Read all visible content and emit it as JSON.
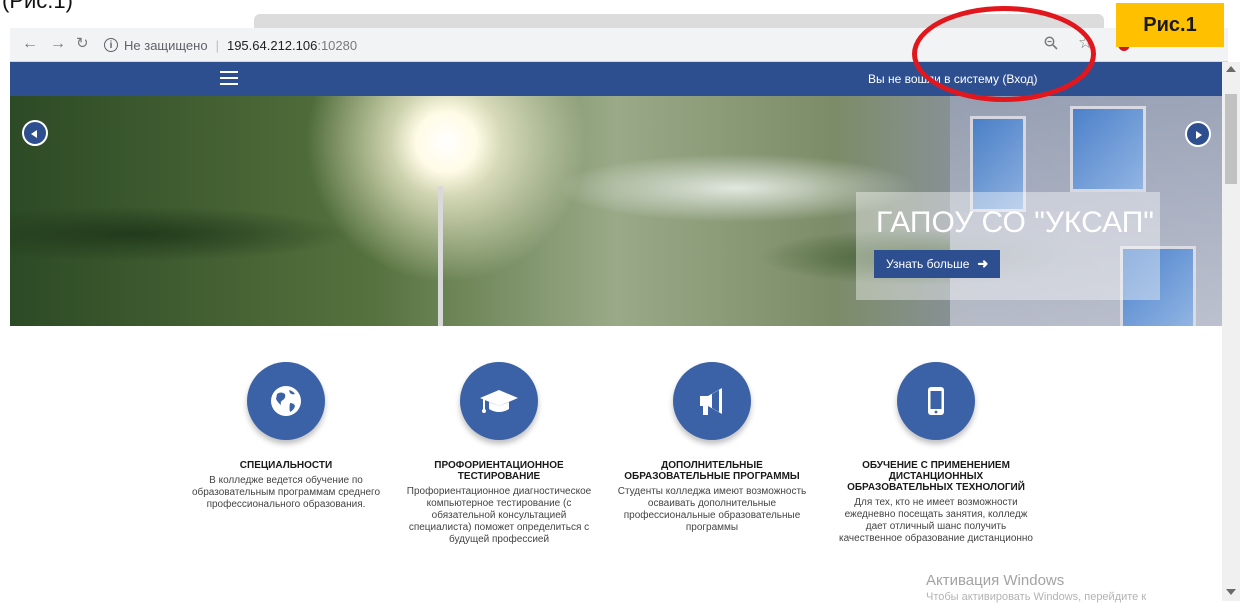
{
  "caption": "(Рис.1)",
  "browser": {
    "security_label": "Не защищено",
    "host": "195.64.212.106",
    "port": ":10280",
    "back_icon": "arrow-left-icon",
    "forward_icon": "arrow-right-icon",
    "reload_icon": "reload-icon"
  },
  "header": {
    "login_text": "Вы не вошли в систему (Вход)"
  },
  "hero": {
    "title": "ГАПОУ СО \"УКСАП\"",
    "button_label": "Узнать больше"
  },
  "features": [
    {
      "icon": "globe-icon",
      "title": "СПЕЦИАЛЬНОСТИ",
      "description": "В колледже ведется обучение по образовательным программам среднего профессионального образования."
    },
    {
      "icon": "graduation-cap-icon",
      "title": "ПРОФОРИЕНТАЦИОННОЕ ТЕСТИРОВАНИЕ",
      "description": "Профориентационное диагностическое компьютерное тестирование (с обязательной консультацией специалиста) поможет определиться с будущей профессией"
    },
    {
      "icon": "megaphone-icon",
      "title": "ДОПОЛНИТЕЛЬНЫЕ ОБРАЗОВАТЕЛЬНЫЕ ПРОГРАММЫ",
      "description": "Студенты колледжа имеют возможность осваивать дополнительные профессиональные образовательные программы"
    },
    {
      "icon": "mobile-phone-icon",
      "title": "ОБУЧЕНИЕ С ПРИМЕНЕНИЕМ ДИСТАНЦИОННЫХ ОБРАЗОВАТЕЛЬНЫХ ТЕХНОЛОГИЙ",
      "description": "Для тех, кто не имеет возможности ежедневно посещать занятия, колледж дает отличный шанс получить качественное образование дистанционно"
    }
  ],
  "figure_label": "Рис.1",
  "watermark": {
    "line1": "Активация Windows",
    "line2": "Чтобы активировать Windows, перейдите к"
  },
  "colors": {
    "header": "#2e4f8f",
    "feature_circle": "#3b62a6",
    "highlight_ring": "#e1171d",
    "label_bg": "#ffc000"
  }
}
